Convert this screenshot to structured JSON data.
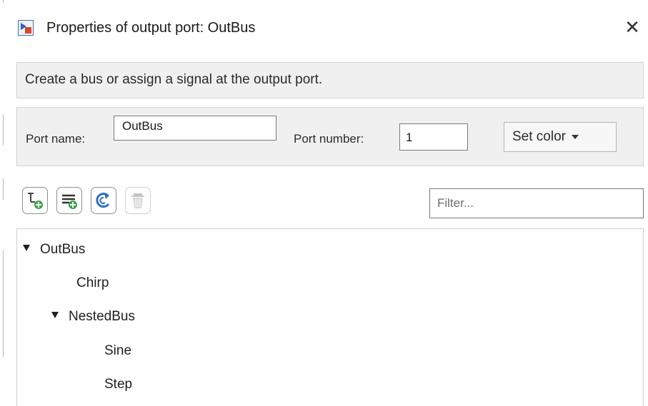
{
  "window": {
    "title": "Properties of output port: OutBus",
    "close_glyph": "✕",
    "icon": "output-port-icon"
  },
  "description": {
    "text": "Create a bus or assign a signal at the output port."
  },
  "port": {
    "name_label": "Port name:",
    "name_value": "OutBus",
    "number_label": "Port number:",
    "number_value": "1",
    "color_button_label": "Set color"
  },
  "toolbar": {
    "buttons": [
      {
        "icon": "add-element-icon",
        "enabled": true
      },
      {
        "icon": "add-signal-icon",
        "enabled": true
      },
      {
        "icon": "refresh-icon",
        "enabled": true
      },
      {
        "icon": "delete-icon",
        "enabled": false
      }
    ],
    "filter_placeholder": "Filter..."
  },
  "tree": {
    "items": [
      {
        "label": "OutBus",
        "level": 0,
        "expanded": true
      },
      {
        "label": "Chirp",
        "level": 1
      },
      {
        "label": "NestedBus",
        "level": 1,
        "expanded": true
      },
      {
        "label": "Sine",
        "level": 2
      },
      {
        "label": "Step",
        "level": 2
      }
    ]
  }
}
